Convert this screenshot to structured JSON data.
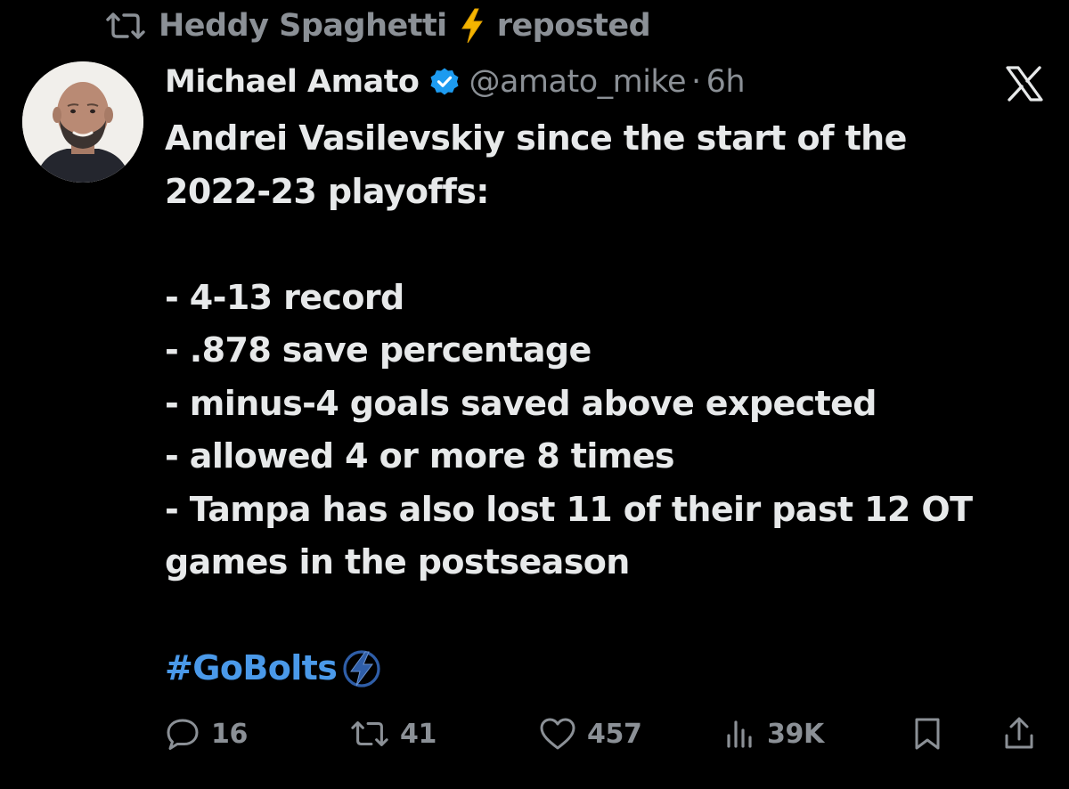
{
  "repost": {
    "reposter_name": "Heddy Spaghetti",
    "reposter_emoji": "lightning-bolt",
    "label": "reposted"
  },
  "author": {
    "name": "Michael Amato",
    "handle": "@amato_mike",
    "separator": "·",
    "time": "6h",
    "verified": true
  },
  "post": {
    "lines": [
      "Andrei Vasilevskiy since the start of the",
      "2022-23 playoffs:",
      "",
      "- 4-13 record",
      "- .878 save percentage",
      "- minus-4 goals saved above expected",
      "- allowed 4 or more 8 times",
      "- Tampa has also lost 11 of their past 12 OT",
      "games in the postseason",
      ""
    ],
    "hashtag": "#GoBolts",
    "hashtag_emoji": "tampa-bay-lightning-logo"
  },
  "actions": {
    "replies": "16",
    "reposts": "41",
    "likes": "457",
    "views": "39K"
  },
  "icons": {
    "repost": "repost-icon",
    "verified": "verified-badge-icon",
    "platform": "x-logo-icon",
    "reply": "reply-icon",
    "like": "heart-icon",
    "views": "views-icon",
    "bookmark": "bookmark-icon",
    "share": "share-icon"
  },
  "colors": {
    "background": "#000000",
    "primary_text": "#e7e9ea",
    "secondary_text": "#8b9096",
    "link": "#4a99e9",
    "verified": "#1d9bf0",
    "bolt_yellow": "#f4b400"
  }
}
